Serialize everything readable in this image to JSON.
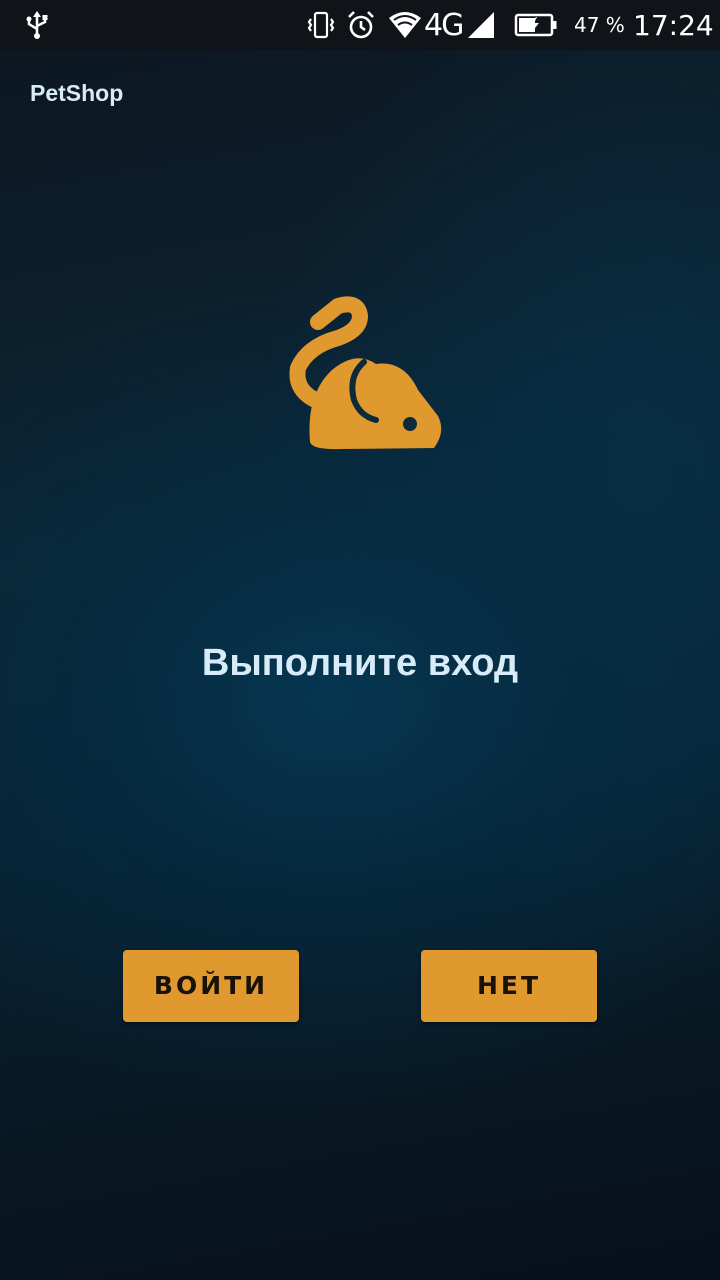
{
  "status_bar": {
    "network": "4G",
    "battery_percent": "47 %",
    "time": "17:24",
    "icons": [
      "usb-icon",
      "vibrate-icon",
      "alarm-icon",
      "wifi-icon",
      "signal-icon",
      "battery-charging-icon"
    ]
  },
  "app": {
    "title": "PetShop",
    "logo_icon": "mouse-icon",
    "heading": "Выполните вход"
  },
  "buttons": {
    "login_label": "ВОЙТИ",
    "no_label": "НЕТ"
  },
  "colors": {
    "accent": "#e0992e",
    "heading_text": "#d7ecf8",
    "status_bar_bg": "#101419"
  }
}
